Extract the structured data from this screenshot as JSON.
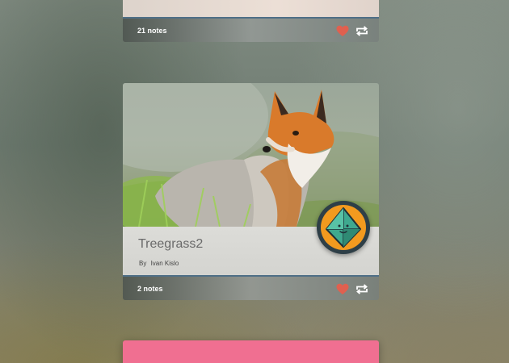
{
  "posts": [
    {
      "notes_label": "21 notes",
      "actions": {
        "like": "heart-icon",
        "reblog": "reblog-icon"
      }
    },
    {
      "title": "Treegrass2",
      "byline_prefix": "By",
      "author": "Ivan Kislo",
      "notes_label": "2 notes",
      "actions": {
        "like": "heart-icon",
        "reblog": "reblog-icon"
      }
    },
    {
      "color": "#f06f91"
    }
  ],
  "colors": {
    "heart": "#e0604f",
    "notes_bar_border": "#4f6f87",
    "avatar_ring": "#f29a1f",
    "avatar_gem": "#3fa98f"
  }
}
